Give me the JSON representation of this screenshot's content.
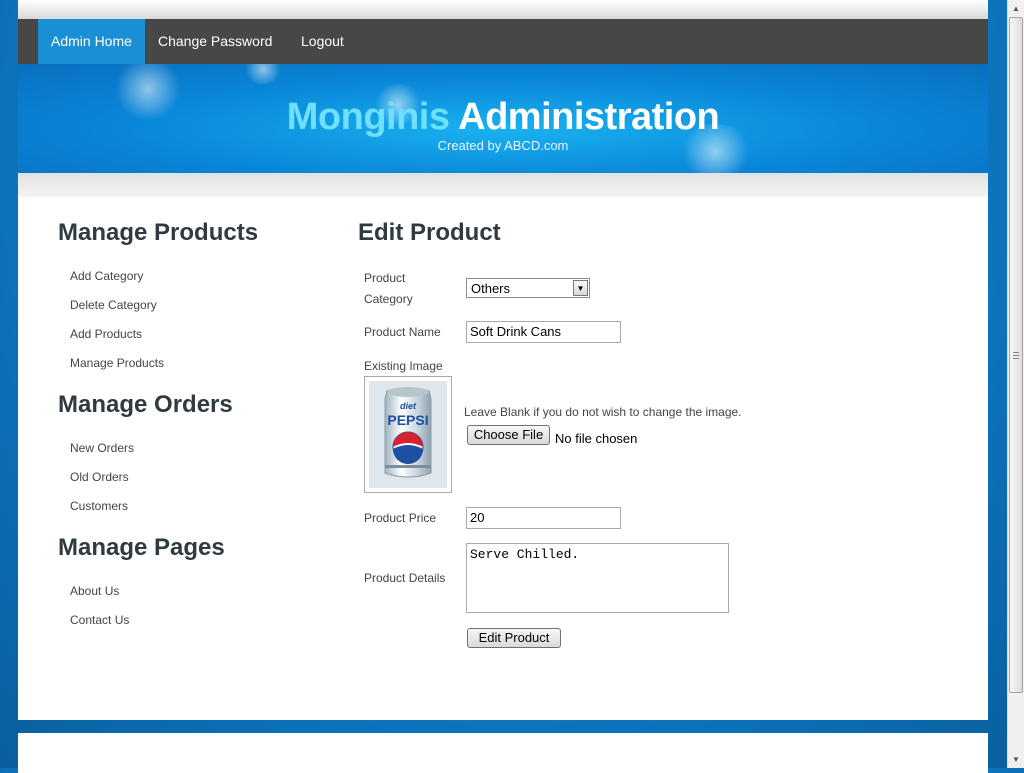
{
  "nav": {
    "items": [
      {
        "label": "Admin Home",
        "active": true
      },
      {
        "label": "Change Password",
        "active": false
      },
      {
        "label": "Logout",
        "active": false
      }
    ]
  },
  "banner": {
    "brand_part1": "Monginis",
    "brand_part2": " Administration",
    "credit": "Created by ABCD.com"
  },
  "sidebar": {
    "products": {
      "heading": "Manage Products",
      "links": [
        "Add Category",
        "Delete Category",
        "Add Products",
        "Manage Products"
      ]
    },
    "orders": {
      "heading": "Manage Orders",
      "links": [
        "New Orders",
        "Old Orders",
        "Customers"
      ]
    },
    "pages": {
      "heading": "Manage Pages",
      "links": [
        "About Us",
        "Contact Us"
      ]
    }
  },
  "form": {
    "title": "Edit Product",
    "category_label_1": "Product",
    "category_label_2": "Category",
    "category_value": "Others",
    "name_label": "Product Name",
    "name_value": "Soft Drink Cans",
    "image_label": "Existing Image",
    "image_hint": "Leave Blank if you do not wish to change the image.",
    "choose_file_label": "Choose File",
    "no_file_text": "No file chosen",
    "price_label": "Product Price",
    "price_value": "20",
    "details_label": "Product Details",
    "details_value": "Serve Chilled.",
    "submit_label": "Edit Product"
  },
  "product_image": {
    "brand_top": "diet",
    "brand_main": "PEPSI"
  },
  "colors": {
    "nav_bg": "#474747",
    "nav_active": "#1a8fd6",
    "page_bg": "#0d7cc8",
    "heading_text": "#2f3b40"
  }
}
